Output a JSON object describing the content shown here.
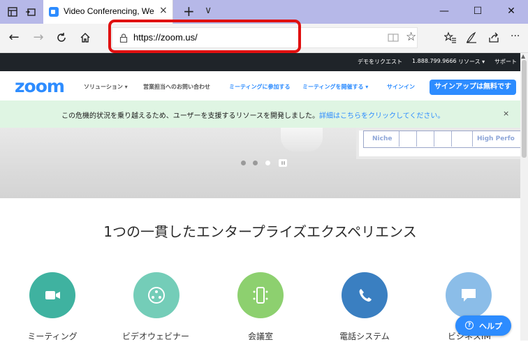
{
  "browser": {
    "tab_title": "Video Conferencing, We",
    "tab_close": "×",
    "new_tab": "+",
    "tab_menu": "∨",
    "win_minimize": "—",
    "win_maximize": "☐",
    "win_close": "✕",
    "url": "https://zoom.us/",
    "more": "···"
  },
  "topstrip": {
    "items": [
      "デモをリクエスト",
      "1.888.799.9666",
      "リソース ▾",
      "サポート"
    ]
  },
  "nav": {
    "logo": "zoom",
    "items": [
      "ソリューション ▾",
      "営業担当へのお問い合わせ",
      "ミーティングに参加する",
      "ミーティングを開催する ▾",
      "サインイン"
    ],
    "signup": "サインアップは無料です"
  },
  "banner": {
    "text": "この危機的状況を乗り越えるため、ユーザーを支援するリソースを開発しました。",
    "link": "詳細はこちらをクリックしてください。",
    "close": "×"
  },
  "hero": {
    "board_left": "Niche",
    "board_right": "High Perfo"
  },
  "heading": "1つの一貫したエンタープライズエクスペリエンス",
  "products": [
    {
      "label": "ミーティング",
      "icon": "video-camera-icon",
      "color": "#3fb2a0"
    },
    {
      "label": "ビデオウェビナー",
      "icon": "webinar-icon",
      "color": "#74cdb8"
    },
    {
      "label": "会議室",
      "icon": "rooms-icon",
      "color": "#8dd06f"
    },
    {
      "label": "電話システム",
      "icon": "phone-icon",
      "color": "#3a7fc1"
    },
    {
      "label": "ビジネスIM",
      "icon": "chat-icon",
      "color": "#8bbde8"
    }
  ],
  "help": {
    "label": "ヘルプ",
    "icon_glyph": "?"
  },
  "colors": {
    "accent": "#2d8cff",
    "highlight": "#e01010",
    "banner_bg": "#dff5e3",
    "topstrip_bg": "#1f2429"
  }
}
